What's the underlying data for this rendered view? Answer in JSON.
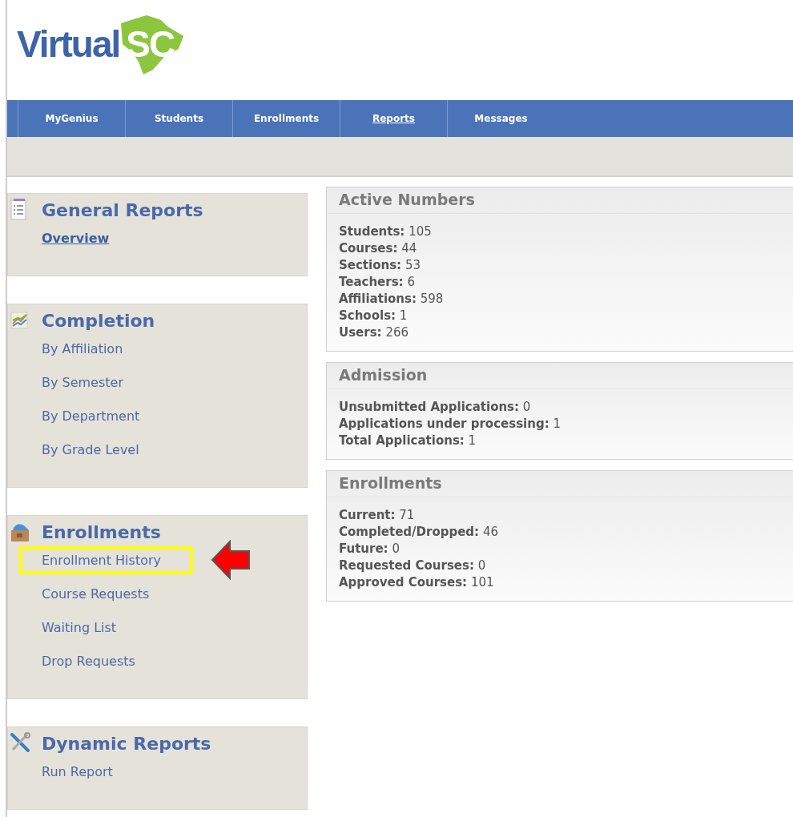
{
  "logo": {
    "word": "Virtual",
    "state": "SC"
  },
  "nav": [
    {
      "label": "MyGenius",
      "selected": false
    },
    {
      "label": "Students",
      "selected": false
    },
    {
      "label": "Enrollments",
      "selected": false
    },
    {
      "label": "Reports",
      "selected": true
    },
    {
      "label": "Messages",
      "selected": false
    }
  ],
  "sidebar": [
    {
      "title": "General Reports",
      "kind": "list",
      "items": [
        {
          "label": "Overview",
          "selected": true,
          "highlighted": false
        }
      ]
    },
    {
      "title": "Completion",
      "kind": "chart",
      "items": [
        {
          "label": "By Affiliation",
          "selected": false,
          "highlighted": false
        },
        {
          "label": "By Semester",
          "selected": false,
          "highlighted": false
        },
        {
          "label": "By Department",
          "selected": false,
          "highlighted": false
        },
        {
          "label": "By Grade Level",
          "selected": false,
          "highlighted": false
        }
      ]
    },
    {
      "title": "Enrollments",
      "kind": "box",
      "items": [
        {
          "label": "Enrollment History",
          "selected": false,
          "highlighted": true
        },
        {
          "label": "Course Requests",
          "selected": false,
          "highlighted": false
        },
        {
          "label": "Waiting List",
          "selected": false,
          "highlighted": false
        },
        {
          "label": "Drop Requests",
          "selected": false,
          "highlighted": false
        }
      ]
    },
    {
      "title": "Dynamic Reports",
      "kind": "tools",
      "items": [
        {
          "label": "Run Report",
          "selected": false,
          "highlighted": false
        }
      ]
    }
  ],
  "panels": [
    {
      "title": "Active Numbers",
      "stats": [
        {
          "label": "Students:",
          "value": "105"
        },
        {
          "label": "Courses:",
          "value": "44"
        },
        {
          "label": "Sections:",
          "value": "53"
        },
        {
          "label": "Teachers:",
          "value": "6"
        },
        {
          "label": "Affiliations:",
          "value": "598"
        },
        {
          "label": "Schools:",
          "value": "1"
        },
        {
          "label": "Users:",
          "value": "266"
        }
      ]
    },
    {
      "title": "Admission",
      "stats": [
        {
          "label": "Unsubmitted Applications:",
          "value": "0"
        },
        {
          "label": "Applications under processing:",
          "value": "1"
        },
        {
          "label": "Total Applications:",
          "value": "1"
        }
      ]
    },
    {
      "title": "Enrollments",
      "stats": [
        {
          "label": "Current:",
          "value": "71"
        },
        {
          "label": "Completed/Dropped:",
          "value": "46"
        },
        {
          "label": "Future:",
          "value": "0"
        },
        {
          "label": "Requested Courses:",
          "value": "0"
        },
        {
          "label": "Approved Courses:",
          "value": "101"
        }
      ]
    }
  ]
}
